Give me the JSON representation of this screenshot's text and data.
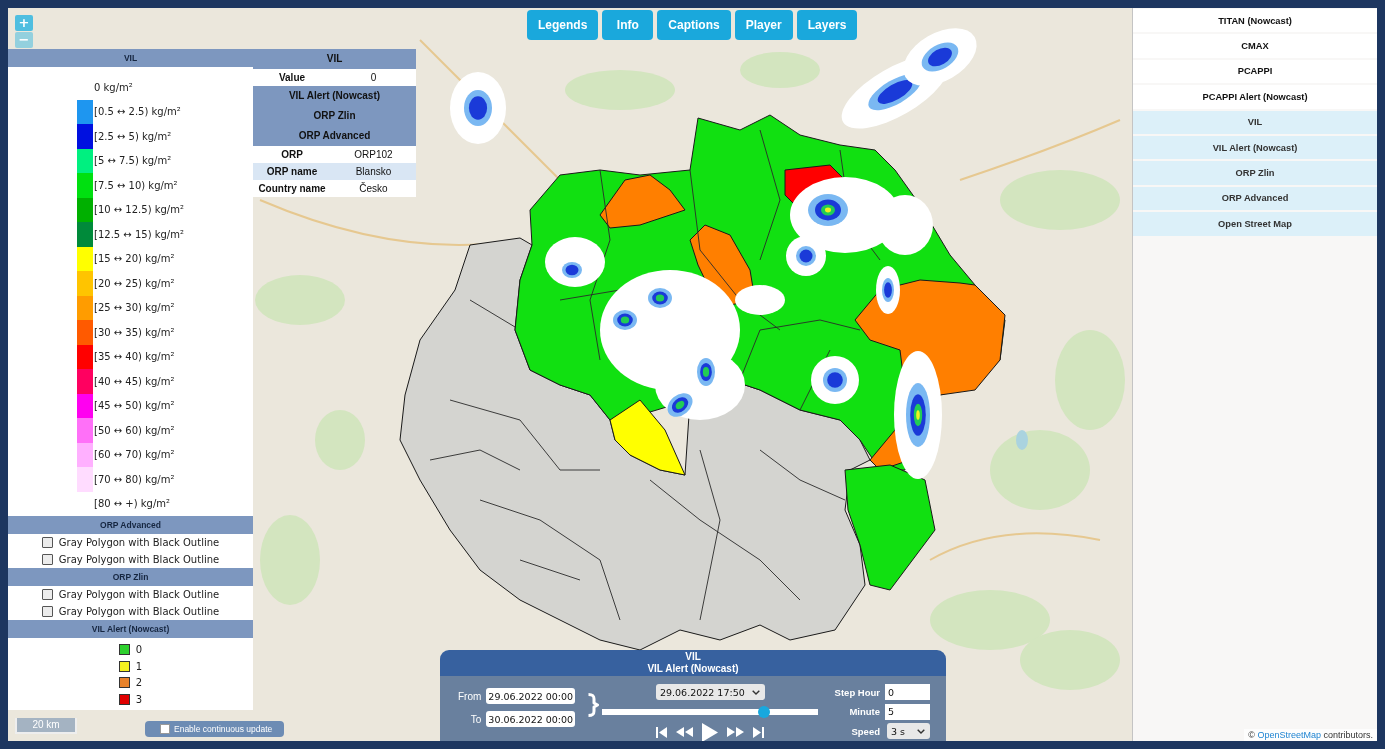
{
  "map_controls": {
    "zoom_in": "+",
    "zoom_out": "−"
  },
  "legend_panel": {
    "sections": [
      {
        "kind": "scale",
        "title": "VIL",
        "items": [
          {
            "label": "0 kg/m²"
          },
          {
            "label": "[0.5 ↔ 2.5) kg/m²",
            "color": "#1e96f0"
          },
          {
            "label": "[2.5 ↔ 5) kg/m²",
            "color": "#0010e0"
          },
          {
            "label": "[5 ↔ 7.5) kg/m²",
            "color": "#00f080"
          },
          {
            "label": "[7.5 ↔ 10) kg/m²",
            "color": "#00e010"
          },
          {
            "label": "[10 ↔ 12.5) kg/m²",
            "color": "#00b000"
          },
          {
            "label": "[12.5 ↔ 15) kg/m²",
            "color": "#008a3a"
          },
          {
            "label": "[15 ↔ 20) kg/m²",
            "color": "#ffff00"
          },
          {
            "label": "[20 ↔ 25) kg/m²",
            "color": "#ffc400"
          },
          {
            "label": "[25 ↔ 30) kg/m²",
            "color": "#ff9c00"
          },
          {
            "label": "[30 ↔ 35) kg/m²",
            "color": "#ff5a00"
          },
          {
            "label": "[35 ↔ 40) kg/m²",
            "color": "#ff0000"
          },
          {
            "label": "[40 ↔ 45) kg/m²",
            "color": "#ff0060"
          },
          {
            "label": "[45 ↔ 50) kg/m²",
            "color": "#ff00f0"
          },
          {
            "label": "[50 ↔ 60) kg/m²",
            "color": "#ff70f8"
          },
          {
            "label": "[60 ↔ 70) kg/m²",
            "color": "#ffb0ff"
          },
          {
            "label": "[70 ↔ 80) kg/m²",
            "color": "#ffdcff"
          },
          {
            "label": "[80 ↔ +) kg/m²"
          }
        ]
      },
      {
        "kind": "checkbox",
        "title": "ORP Advanced",
        "items": [
          {
            "label": "Gray Polygon with Black Outline",
            "checked": false
          },
          {
            "label": "Gray Polygon with Black Outline",
            "checked": false
          }
        ]
      },
      {
        "kind": "checkbox",
        "title": "ORP Zlin",
        "items": [
          {
            "label": "Gray Polygon with Black Outline",
            "checked": false
          },
          {
            "label": "Gray Polygon with Black Outline",
            "checked": false
          }
        ]
      },
      {
        "kind": "swatch",
        "title": "VIL Alert (Nowcast)",
        "items": [
          {
            "label": "0",
            "color": "#2ed02e"
          },
          {
            "label": "1",
            "color": "#f4f020"
          },
          {
            "label": "2",
            "color": "#e8822a"
          },
          {
            "label": "3",
            "color": "#e00000"
          }
        ]
      }
    ]
  },
  "info_panel": {
    "sections": [
      {
        "title": "VIL",
        "rows": [
          {
            "label": "Value",
            "value": "0"
          }
        ]
      },
      {
        "title": "VIL Alert (Nowcast)"
      },
      {
        "title": "ORP Zlin"
      },
      {
        "title": "ORP Advanced",
        "rows": [
          {
            "label": "ORP",
            "value": "ORP102"
          },
          {
            "label": "ORP name",
            "value": "Blansko"
          },
          {
            "label": "Country name",
            "value": "Česko"
          }
        ]
      }
    ]
  },
  "toolbar": [
    "Legends",
    "Info",
    "Captions",
    "Player",
    "Layers"
  ],
  "layers_panel": {
    "items": [
      {
        "label": "TITAN (Nowcast)",
        "selected": false
      },
      {
        "label": "CMAX",
        "selected": false
      },
      {
        "label": "PCAPPI",
        "selected": false
      },
      {
        "label": "PCAPPI Alert (Nowcast)",
        "selected": false
      },
      {
        "label": "VIL",
        "selected": true
      },
      {
        "label": "VIL Alert (Nowcast)",
        "selected": true
      },
      {
        "label": "ORP Zlin",
        "selected": true
      },
      {
        "label": "ORP Advanced",
        "selected": true
      },
      {
        "label": "Open Street Map",
        "selected": true
      }
    ]
  },
  "player": {
    "titles": [
      "VIL",
      "VIL Alert (Nowcast)"
    ],
    "from": {
      "label": "From",
      "value": "29.06.2022 00:00"
    },
    "to": {
      "label": "To",
      "value": "30.06.2022 00:00"
    },
    "time_select": {
      "value": "29.06.2022 17:50"
    },
    "timeline": {
      "level": 0.75
    },
    "playback": [
      {
        "kind": "first"
      },
      {
        "kind": "rewind"
      },
      {
        "kind": "play"
      },
      {
        "kind": "forward"
      },
      {
        "kind": "last"
      }
    ],
    "steps": [
      {
        "label": "Step Hour",
        "value": "0"
      },
      {
        "label": "Minute",
        "value": "5"
      }
    ],
    "speed": {
      "label": "Speed",
      "value": "3 s"
    }
  },
  "scale_bar": "20 km",
  "continuous_update": {
    "label": "Enable continuous update",
    "checked": false
  },
  "attribution": {
    "before": "©",
    "link": "OpenStreetMap",
    "after": "contributors."
  }
}
